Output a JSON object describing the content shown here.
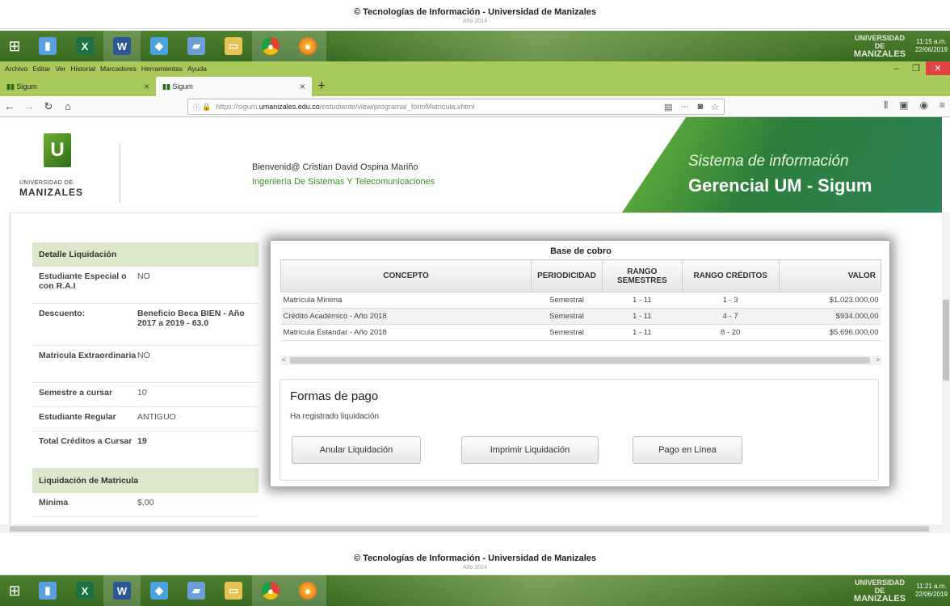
{
  "top_footer": {
    "text": "© Tecnologías de Información - Universidad de Manizales",
    "small": "Año 2014"
  },
  "bottom_footer": {
    "text": "© Tecnologías de Información - Universidad de Manizales",
    "small": "Año 2014"
  },
  "taskbar_top": {
    "clock_time": "11:15 a.m.",
    "clock_date": "22/06/2019",
    "logo_line1": "UNIVERSIDAD DE",
    "logo_line2": "MANIZALES"
  },
  "taskbar_bottom": {
    "clock_time": "11:21 a.m.",
    "clock_date": "22/06/2019",
    "logo_line1": "UNIVERSIDAD DE",
    "logo_line2": "MANIZALES"
  },
  "taskbar_apps": [
    "windows-explorer-icon",
    "excel-icon",
    "word-icon",
    "photos-icon",
    "notepad-icon",
    "folder-icon",
    "chrome-icon",
    "firefox-icon"
  ],
  "browser": {
    "menu": [
      "Archivo",
      "Editar",
      "Ver",
      "Historial",
      "Marcadores",
      "Herramientas",
      "Ayuda"
    ],
    "tabs": [
      {
        "label": "Sigum"
      },
      {
        "label": "Sigum"
      }
    ],
    "url_prefix": "https://sigum.",
    "url_domain": "umanizales.edu.co",
    "url_path": "/estudiante/view/programa/_formMatricula.xhtml"
  },
  "header": {
    "logo_line1": "UNIVERSIDAD DE",
    "logo_line2": "MANIZALES",
    "welcome": "Bienvenid@ Cristian David Ospina Mariño",
    "program": "Ingeniería De Sistemas Y Telecomunicaciones",
    "banner_line1": "Sistema de información",
    "banner_line2": "Gerencial UM - Sigum"
  },
  "detail": {
    "title": "Detalle Liquidación",
    "rows": [
      {
        "k": "Estudiante Especial o con R.A.I",
        "v": "NO"
      },
      {
        "k": "Descuento:",
        "v": "Beneficio Beca BIEN - Año 2017 a 2019 - 63.0"
      },
      {
        "k": "Matricula Extraordinaria",
        "v": "NO"
      },
      {
        "k": "Semestre a cursar",
        "v": "10"
      },
      {
        "k": "Estudiante Regular",
        "v": "ANTIGUO"
      },
      {
        "k": "Total Créditos a Cursar",
        "v": "19"
      }
    ],
    "liq_title": "Liquidación de Matricula",
    "liq_rows": [
      {
        "k": "Minima",
        "v": "$,00"
      }
    ]
  },
  "modal": {
    "title": "Base de cobro",
    "columns": [
      "CONCEPTO",
      "PERIODICIDAD",
      "RANGO SEMESTRES",
      "RANGO CRÉDITOS",
      "VALOR"
    ],
    "rows": [
      [
        "Matrícula Mínima",
        "Semestral",
        "1 - 11",
        "1 - 3",
        "$1.023.000,00"
      ],
      [
        "Crédito Académico - Año 2018",
        "Semestral",
        "1 - 11",
        "4 - 7",
        "$934.000,00"
      ],
      [
        "Matrícula Estandar - Año 2018",
        "Semestral",
        "1 - 11",
        "8 - 20",
        "$5.696.000,00"
      ]
    ]
  },
  "pago": {
    "title": "Formas de pago",
    "status": "Ha registrado liquidación",
    "btn_anular": "Anular Liquidación",
    "btn_imprimir": "Imprimir Liquidación",
    "btn_pago": "Pago en Línea"
  }
}
